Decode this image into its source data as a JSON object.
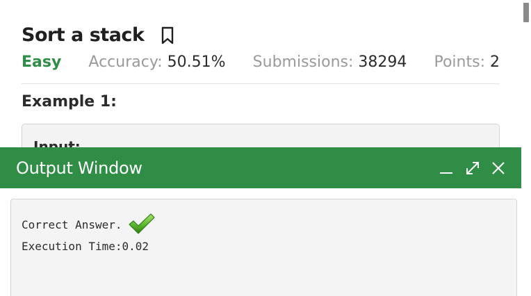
{
  "problem": {
    "title": "Sort a stack",
    "difficulty": "Easy",
    "accuracy_label": "Accuracy:",
    "accuracy_value": "50.51%",
    "submissions_label": "Submissions:",
    "submissions_value": "38294",
    "points_label": "Points:",
    "points_value": "2",
    "bookmark_icon": "bookmark-icon"
  },
  "example": {
    "heading": "Example 1:",
    "input_label": "Input:"
  },
  "output_window": {
    "title": "Output Window",
    "icons": [
      "minimize-icon",
      "expand-icon",
      "close-icon"
    ],
    "result": "Correct Answer.",
    "result_icon": "check-icon",
    "execution_time": "Execution Time:0.02"
  },
  "colors": {
    "accent_green": "#2f8d46",
    "check_green": "#5cb82e"
  }
}
